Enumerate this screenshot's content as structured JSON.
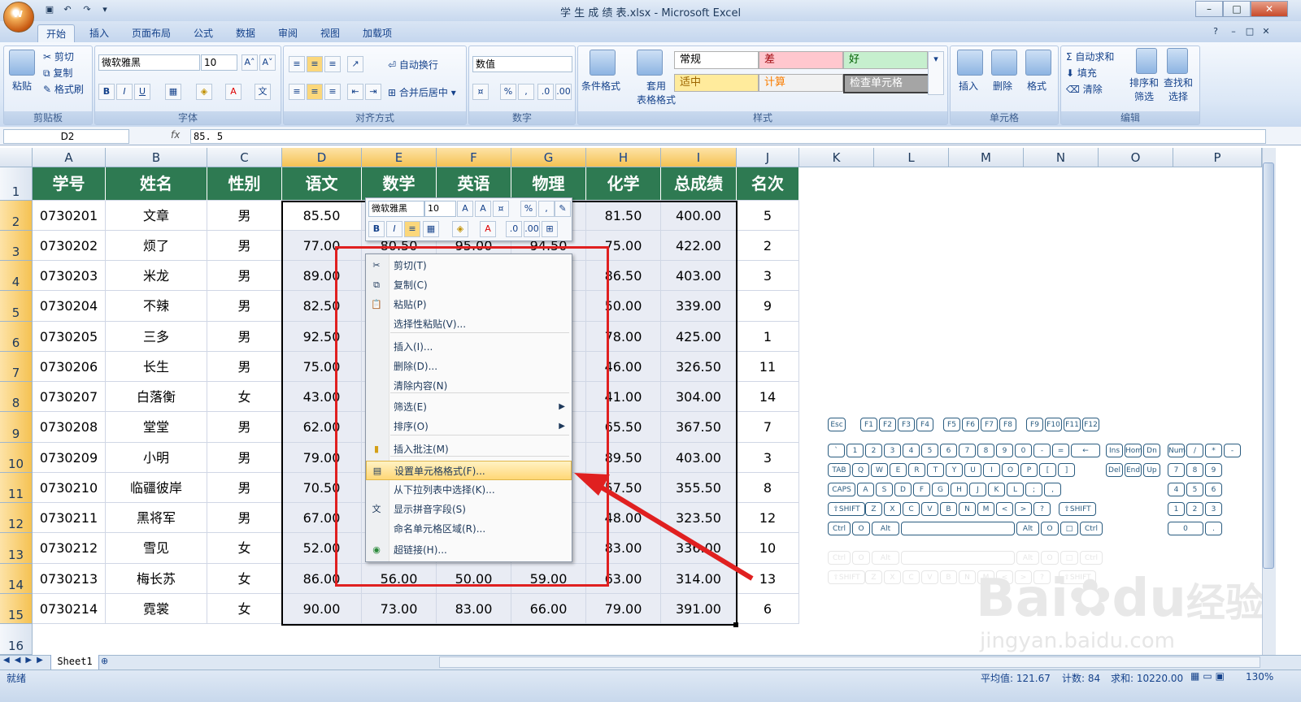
{
  "window": {
    "title": "学 生 成 绩 表.xlsx - Microsoft Excel",
    "office_logo": "W",
    "minimize": "–",
    "maximize": "□",
    "close": "✕",
    "help": "?",
    "doc_min": "–",
    "doc_max": "□",
    "doc_close": "✕"
  },
  "ribbon": {
    "tabs": [
      "开始",
      "插入",
      "页面布局",
      "公式",
      "数据",
      "审阅",
      "视图",
      "加载项"
    ],
    "clipboard": {
      "paste": "粘贴",
      "cut": "剪切",
      "copy": "复制",
      "format_painter": "格式刷",
      "label": "剪贴板"
    },
    "font": {
      "name": "微软雅黑",
      "size": "10",
      "grow": "A˄",
      "shrink": "A˅",
      "bold": "B",
      "italic": "I",
      "underline": "U",
      "label": "字体"
    },
    "alignment": {
      "wrap": "自动换行",
      "merge": "合并后居中",
      "label": "对齐方式"
    },
    "number": {
      "format": "数值",
      "percent": "%",
      "comma": ",",
      "label": "数字"
    },
    "styles": {
      "conditional": "条件格式",
      "table": "套用\n表格格式",
      "normal": "常规",
      "bad": "差",
      "good": "好",
      "neutral": "适中",
      "calc": "计算",
      "check": "检查单元格",
      "label": "样式"
    },
    "cells": {
      "insert": "插入",
      "delete": "删除",
      "format": "格式",
      "label": "单元格"
    },
    "editing": {
      "autosum": "自动求和",
      "fill": "填充",
      "clear": "清除",
      "sort": "排序和\n筛选",
      "find": "查找和\n选择",
      "label": "编辑"
    }
  },
  "formula_bar": {
    "name_box": "D2",
    "fx": "fx",
    "value": "85. 5"
  },
  "grid": {
    "columns": [
      "A",
      "B",
      "C",
      "D",
      "E",
      "F",
      "G",
      "H",
      "I",
      "J",
      "K",
      "L",
      "M",
      "N",
      "O",
      "P"
    ],
    "rows": [
      "1",
      "2",
      "3",
      "4",
      "5",
      "6",
      "7",
      "8",
      "9",
      "10",
      "11",
      "12",
      "13",
      "14",
      "15",
      "16"
    ],
    "headers": [
      "学号",
      "姓名",
      "性别",
      "语文",
      "数学",
      "英语",
      "物理",
      "化学",
      "总成绩",
      "名次"
    ],
    "data": [
      [
        "0730201",
        "文章",
        "男",
        "85.50",
        "",
        "",
        "",
        "81.50",
        "400.00",
        "5"
      ],
      [
        "0730202",
        "烦了",
        "男",
        "77.00",
        "80.50",
        "95.00",
        "94.50",
        "75.00",
        "422.00",
        "2"
      ],
      [
        "0730203",
        "米龙",
        "男",
        "89.00",
        "",
        "",
        "",
        "86.50",
        "403.00",
        "3"
      ],
      [
        "0730204",
        "不辣",
        "男",
        "82.50",
        "",
        "",
        "",
        "50.00",
        "339.00",
        "9"
      ],
      [
        "0730205",
        "三多",
        "男",
        "92.50",
        "",
        "",
        "",
        "78.00",
        "425.00",
        "1"
      ],
      [
        "0730206",
        "长生",
        "男",
        "75.00",
        "",
        "",
        "",
        "46.00",
        "326.50",
        "11"
      ],
      [
        "0730207",
        "白落衡",
        "女",
        "43.00",
        "",
        "",
        "",
        "41.00",
        "304.00",
        "14"
      ],
      [
        "0730208",
        "堂堂",
        "男",
        "62.00",
        "",
        "",
        "",
        "65.50",
        "367.50",
        "7"
      ],
      [
        "0730209",
        "小明",
        "男",
        "79.00",
        "",
        "",
        "",
        "89.50",
        "403.00",
        "3"
      ],
      [
        "0730210",
        "临疆彼岸",
        "男",
        "70.50",
        "",
        "",
        "",
        "57.50",
        "355.50",
        "8"
      ],
      [
        "0730211",
        "黑将军",
        "男",
        "67.00",
        "",
        "",
        "",
        "48.00",
        "323.50",
        "12"
      ],
      [
        "0730212",
        "雪见",
        "女",
        "52.00",
        "",
        "",
        "",
        "83.00",
        "336.00",
        "10"
      ],
      [
        "0730213",
        "梅长苏",
        "女",
        "86.00",
        "56.00",
        "50.00",
        "59.00",
        "63.00",
        "314.00",
        "13"
      ],
      [
        "0730214",
        "霓裳",
        "女",
        "90.00",
        "73.00",
        "83.00",
        "66.00",
        "79.00",
        "391.00",
        "6"
      ]
    ]
  },
  "mini_toolbar": {
    "font": "微软雅黑",
    "size": "10",
    "bold": "B",
    "italic": "I",
    "percent": "%",
    "comma": ","
  },
  "context_menu": {
    "items": [
      {
        "label": "剪切(T)",
        "icon": "scissors-icon"
      },
      {
        "label": "复制(C)",
        "icon": "copy-icon"
      },
      {
        "label": "粘贴(P)",
        "icon": "paste-icon"
      },
      {
        "label": "选择性粘贴(V)...",
        "icon": ""
      },
      {
        "label": "插入(I)...",
        "icon": ""
      },
      {
        "label": "删除(D)...",
        "icon": ""
      },
      {
        "label": "清除内容(N)",
        "icon": ""
      },
      {
        "label": "筛选(E)",
        "icon": ""
      },
      {
        "label": "排序(O)",
        "icon": ""
      },
      {
        "label": "插入批注(M)",
        "icon": "comment-icon"
      },
      {
        "label": "设置单元格格式(F)...",
        "icon": "format-cells-icon"
      },
      {
        "label": "从下拉列表中选择(K)...",
        "icon": ""
      },
      {
        "label": "显示拼音字段(S)",
        "icon": "phonetic-icon"
      },
      {
        "label": "命名单元格区域(R)...",
        "icon": ""
      },
      {
        "label": "超链接(H)...",
        "icon": "hyperlink-icon"
      }
    ]
  },
  "sheet_tabs": {
    "active": "Sheet1"
  },
  "status": {
    "ready": "就绪",
    "average": "平均值: 121.67",
    "count": "计数: 84",
    "sum": "求和: 10220.00",
    "zoom": "130%"
  },
  "keyboard": {
    "row0": [
      "Esc",
      "F1",
      "F2",
      "F3",
      "F4",
      "F5",
      "F6",
      "F7",
      "F8",
      "F9",
      "F10",
      "F11",
      "F12"
    ],
    "row1": [
      "`",
      "1",
      "2",
      "3",
      "4",
      "5",
      "6",
      "7",
      "8",
      "9",
      "0",
      "-",
      "=",
      "←"
    ],
    "row2": [
      "TAB",
      "Q",
      "W",
      "E",
      "R",
      "T",
      "Y",
      "U",
      "I",
      "O",
      "P",
      "[",
      "]"
    ],
    "row3": [
      "CAPS",
      "A",
      "S",
      "D",
      "F",
      "G",
      "H",
      "J",
      "K",
      "L",
      ";",
      ","
    ],
    "row4": [
      "⇧SHIFT",
      "Z",
      "X",
      "C",
      "V",
      "B",
      "N",
      "M",
      "<",
      ">",
      "?",
      "⇧SHIFT"
    ],
    "row5": [
      "Ctrl",
      "O",
      "Alt",
      "",
      "Alt",
      "O",
      "□",
      "Ctrl"
    ],
    "nav1": [
      "Ins",
      "Hom",
      "Dn"
    ],
    "nav2": [
      "Del",
      "End",
      "Up"
    ],
    "num1": [
      "Num",
      "/",
      "*",
      "-"
    ],
    "num2": [
      "7",
      "8",
      "9"
    ],
    "num3": [
      "4",
      "5",
      "6"
    ],
    "num4": [
      "1",
      "2",
      "3"
    ],
    "num5": [
      "0",
      "."
    ]
  },
  "watermark": {
    "brand": "Bai",
    "brand2": "du",
    "cn": "经验",
    "url": "jingyan.baidu.com"
  },
  "colors": {
    "header_green": "#2e7a52",
    "highlight_red": "#e02020",
    "selection_orange": "#f5c253"
  }
}
